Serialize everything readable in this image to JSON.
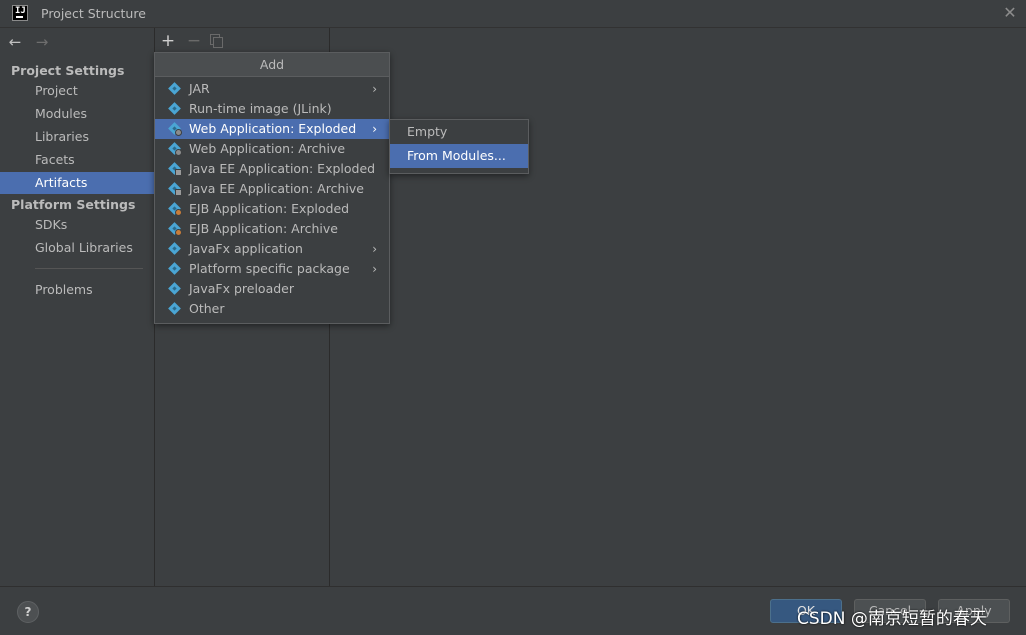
{
  "window": {
    "title": "Project Structure",
    "close_glyph": "✕",
    "app_icon_text": "IJ"
  },
  "nav": {
    "back_glyph": "←",
    "forward_glyph": "→"
  },
  "sidebar": {
    "project_settings_header": "Project Settings",
    "project_items": [
      "Project",
      "Modules",
      "Libraries",
      "Facets",
      "Artifacts"
    ],
    "selected": "Artifacts",
    "platform_settings_header": "Platform Settings",
    "platform_items": [
      "SDKs",
      "Global Libraries"
    ],
    "problems": "Problems"
  },
  "toolbar": {
    "add_glyph": "+",
    "remove_glyph": "−"
  },
  "add_popup": {
    "title": "Add",
    "items": [
      {
        "label": "JAR",
        "has_submenu": true,
        "badge": ""
      },
      {
        "label": "Run-time image (JLink)",
        "has_submenu": false,
        "badge": ""
      },
      {
        "label": "Web Application: Exploded",
        "has_submenu": true,
        "badge": "globe",
        "highlighted": true
      },
      {
        "label": "Web Application: Archive",
        "has_submenu": false,
        "badge": "globe"
      },
      {
        "label": "Java EE Application: Exploded",
        "has_submenu": false,
        "badge": "doc"
      },
      {
        "label": "Java EE Application: Archive",
        "has_submenu": false,
        "badge": "doc"
      },
      {
        "label": "EJB Application: Exploded",
        "has_submenu": false,
        "badge": "bean"
      },
      {
        "label": "EJB Application: Archive",
        "has_submenu": false,
        "badge": "bean"
      },
      {
        "label": "JavaFx application",
        "has_submenu": true,
        "badge": ""
      },
      {
        "label": "Platform specific package",
        "has_submenu": true,
        "badge": ""
      },
      {
        "label": "JavaFx preloader",
        "has_submenu": false,
        "badge": ""
      },
      {
        "label": "Other",
        "has_submenu": false,
        "badge": ""
      }
    ],
    "chevron_glyph": "›"
  },
  "submenu": {
    "items": [
      "Empty",
      "From Modules..."
    ],
    "highlighted_index": 1
  },
  "bottom": {
    "help_label": "?",
    "ok_label": "OK",
    "cancel_label": "Cancel",
    "apply_label": "Apply"
  },
  "watermark": "CSDN @南京短暂的春天",
  "colors": {
    "background": "#3c3f41",
    "selection": "#4b6eaf",
    "icon_blue": "#4aa5d4"
  }
}
